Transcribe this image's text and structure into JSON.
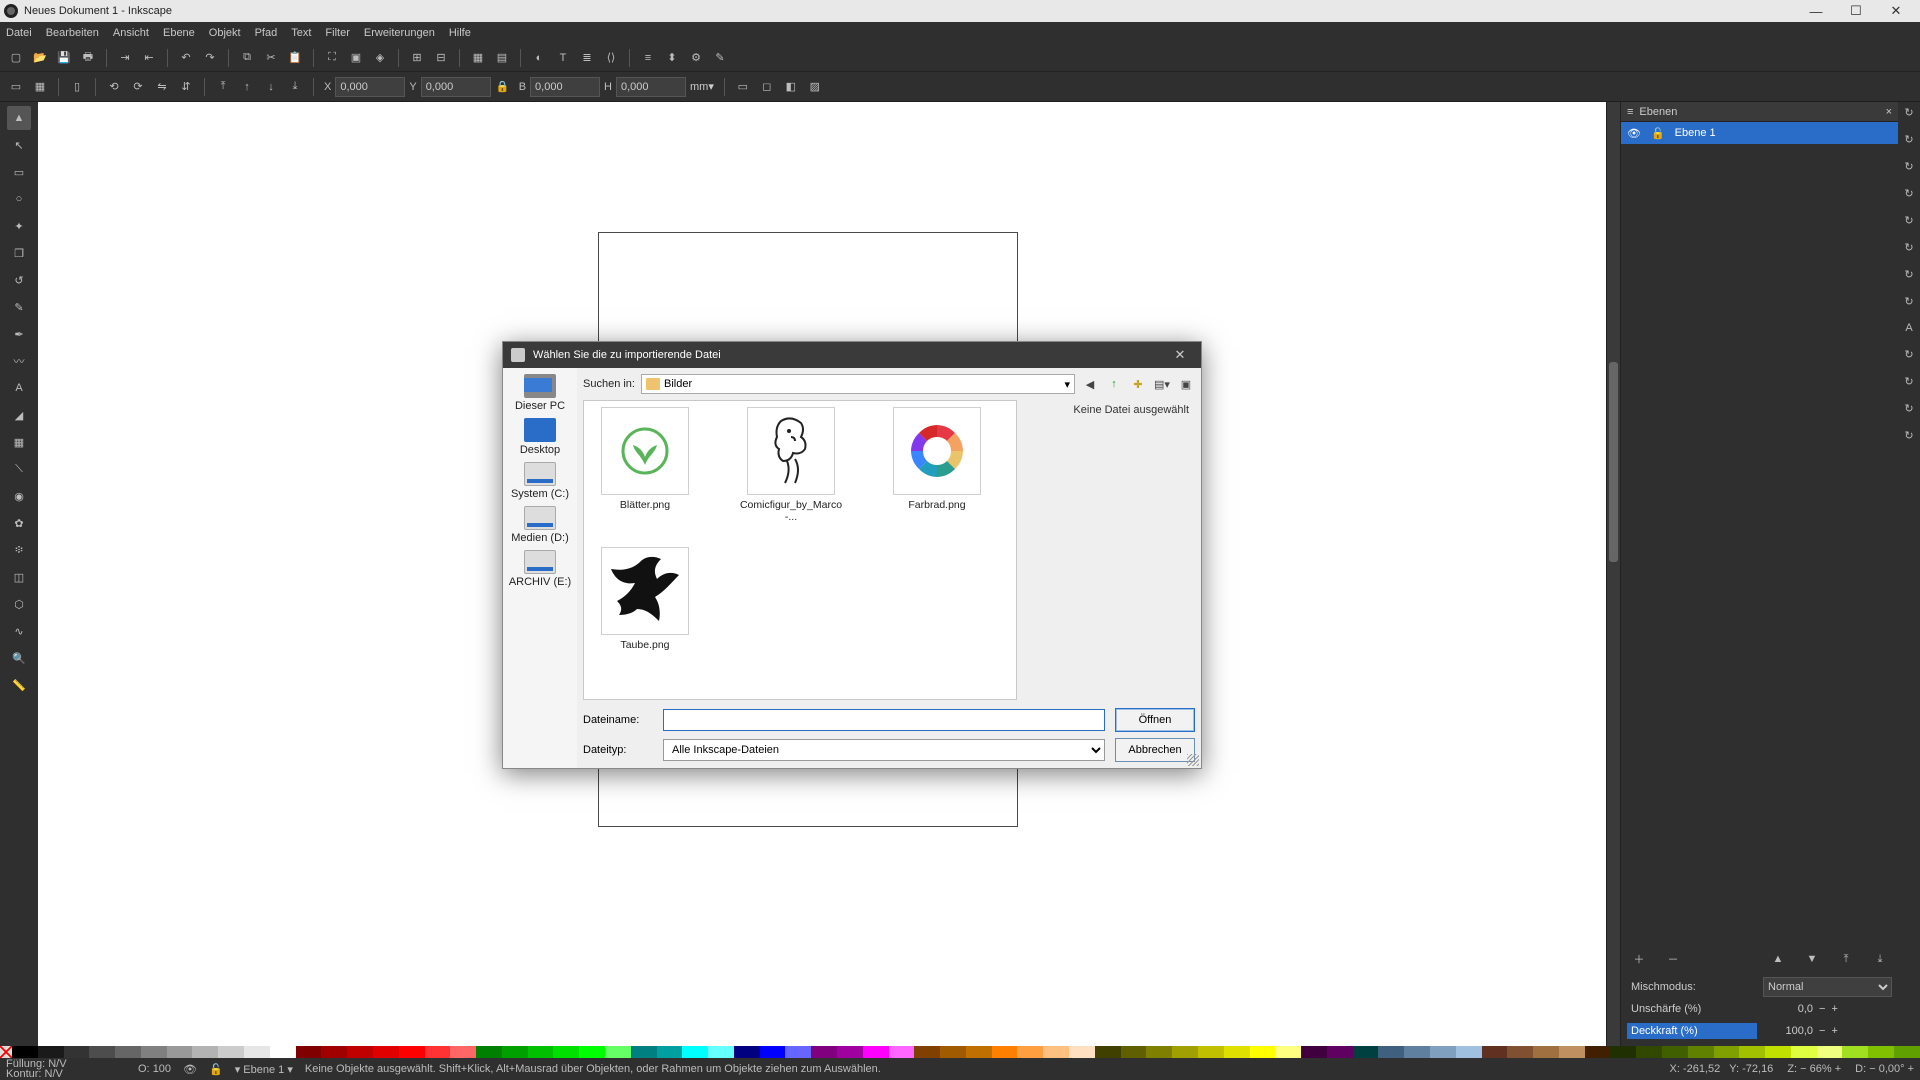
{
  "window": {
    "title": "Neues Dokument 1 - Inkscape"
  },
  "menu": [
    "Datei",
    "Bearbeiten",
    "Ansicht",
    "Ebene",
    "Objekt",
    "Pfad",
    "Text",
    "Filter",
    "Erweiterungen",
    "Hilfe"
  ],
  "toolopts": {
    "x_label": "X",
    "x": "0,000",
    "y_label": "Y",
    "y": "0,000",
    "w_label": "B",
    "w": "0,000",
    "h_label": "H",
    "h": "0,000",
    "unit": "mm"
  },
  "layers_panel": {
    "title": "Ebenen",
    "items": [
      {
        "name": "Ebene 1"
      }
    ],
    "blend_label": "Mischmodus:",
    "blend_value": "Normal",
    "blur_label": "Unschärfe (%)",
    "blur_value": "0,0",
    "opacity_label": "Deckkraft (%)",
    "opacity_value": "100,0"
  },
  "dialog": {
    "title": "Wählen Sie die zu importierende Datei",
    "lookin_label": "Suchen in:",
    "lookin_value": "Bilder",
    "nav": [
      "Dieser PC",
      "Desktop",
      "System (C:)",
      "Medien (D:)",
      "ARCHIV (E:)"
    ],
    "files": [
      {
        "name": "Blätter.png",
        "kind": "leaf"
      },
      {
        "name": "Comicfigur_by_Marco-...",
        "kind": "comic"
      },
      {
        "name": "Farbrad.png",
        "kind": "wheel"
      },
      {
        "name": "Taube.png",
        "kind": "dove"
      }
    ],
    "preview_empty": "Keine Datei ausgewählt",
    "filename_label": "Dateiname:",
    "filename_value": "",
    "filetype_label": "Dateityp:",
    "filetype_value": "Alle Inkscape-Dateien",
    "open": "Öffnen",
    "cancel": "Abbrechen"
  },
  "status": {
    "fill_label": "Füllung:",
    "fill_value": "N/V",
    "stroke_label": "Kontur:",
    "stroke_value": "N/V",
    "o_label": "O:",
    "o_value": "100",
    "layer": "Ebene 1",
    "hint": "Keine Objekte ausgewählt. Shift+Klick, Alt+Mausrad über Objekten, oder Rahmen um Objekte ziehen zum Auswählen.",
    "coord_x_label": "X:",
    "coord_x": "-261,52",
    "coord_y_label": "Y:",
    "coord_y": "-72,16",
    "zoom_label": "Z:",
    "zoom": "66%",
    "rot_label": "D:",
    "rot": "0,00°"
  },
  "palette_colors": [
    "#000",
    "#1a1a1a",
    "#333",
    "#4d4d4d",
    "#666",
    "#808080",
    "#999",
    "#b3b3b3",
    "#ccc",
    "#e6e6e6",
    "#fff",
    "#800000",
    "#a00000",
    "#c00000",
    "#e00000",
    "#ff0000",
    "#ff3333",
    "#ff6666",
    "#008000",
    "#00a000",
    "#00c000",
    "#00e000",
    "#00ff00",
    "#66ff66",
    "#008080",
    "#00a0a0",
    "#00ffff",
    "#66ffff",
    "#000080",
    "#0000ff",
    "#6666ff",
    "#800080",
    "#a000a0",
    "#ff00ff",
    "#ff66ff",
    "#804000",
    "#a05a00",
    "#c07000",
    "#ff8000",
    "#ffa040",
    "#ffc080",
    "#ffe0c0",
    "#404000",
    "#606000",
    "#808000",
    "#a0a000",
    "#c0c000",
    "#e0e000",
    "#ffff00",
    "#ffff80",
    "#400040",
    "#600060",
    "#004040",
    "#406080",
    "#6080a0",
    "#80a0c0",
    "#a0c0e0",
    "#603020",
    "#805030",
    "#a07040",
    "#c09060",
    "#402000",
    "#203000",
    "#304800",
    "#406000",
    "#608000",
    "#80a000",
    "#a0c000",
    "#c0e000",
    "#e0ff40",
    "#f0ff80",
    "#a0e020",
    "#80c000",
    "#60a000"
  ]
}
